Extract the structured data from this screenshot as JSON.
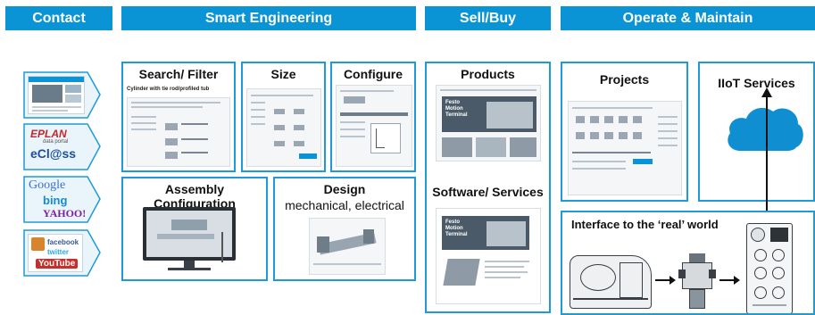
{
  "headers": {
    "contact": "Contact",
    "smart_engineering": "Smart Engineering",
    "sell_buy": "Sell/Buy",
    "operate_maintain": "Operate & Maintain"
  },
  "contact_tabs": {
    "eplan": "EPLAN",
    "eplan_sub": "data portal",
    "eclass": "eCl@ss",
    "google": "Google",
    "bing": "bing",
    "yahoo": "YAHOO!",
    "facebook": "facebook",
    "twitter": "twitter",
    "youtube": "YouTube"
  },
  "panels": {
    "search_filter": "Search/ Filter",
    "search_filter_caption": "Cylinder with tie rod/profiled tub",
    "size": "Size",
    "configure": "Configure",
    "assembly_configuration": "Assembly Configuration",
    "design": "Design",
    "design_sub": "mechanical, electrical",
    "products": "Products",
    "products_screen_text": "Festo Motion Terminal",
    "software_services": "Software/ Services",
    "software_screen_text": "Festo Motion Terminal",
    "projects": "Projects",
    "iiot_services": "IIoT Services",
    "interface_real_world": "Interface to the ‘real’ world"
  },
  "colors": {
    "brand_blue": "#0a94d6",
    "border_blue": "#1e9ad9",
    "cloud_blue": "#0f8fd2"
  },
  "icons": [
    "cloud-icon",
    "arrow-up-icon",
    "arrow-right-icon",
    "machine-icon",
    "valve-icon",
    "controller-icon"
  ]
}
